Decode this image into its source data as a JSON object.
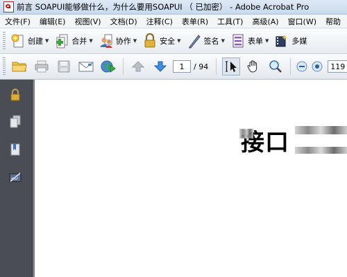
{
  "window": {
    "title": "前言 SOAPUI能够做什么，为什么要用SOAPUI （ 已加密） - Adobe Acrobat Pro"
  },
  "menubar": {
    "items": [
      {
        "label": "文件(F)"
      },
      {
        "label": "编辑(E)"
      },
      {
        "label": "视图(V)"
      },
      {
        "label": "文档(D)"
      },
      {
        "label": "注释(C)"
      },
      {
        "label": "表单(R)"
      },
      {
        "label": "工具(T)"
      },
      {
        "label": "高级(A)"
      },
      {
        "label": "窗口(W)"
      },
      {
        "label": "帮助"
      }
    ]
  },
  "toolbar": {
    "buttons": [
      {
        "label": "创建",
        "icon": "create-icon"
      },
      {
        "label": "合并",
        "icon": "combine-icon"
      },
      {
        "label": "协作",
        "icon": "collaborate-icon"
      },
      {
        "label": "安全",
        "icon": "lock-icon"
      },
      {
        "label": "签名",
        "icon": "pen-icon"
      },
      {
        "label": "表单",
        "icon": "forms-icon"
      },
      {
        "label": "多媒",
        "icon": "multimedia-icon"
      }
    ]
  },
  "navigation": {
    "current_page": "1",
    "total_pages": "/ 94",
    "zoom": "119"
  },
  "document": {
    "heading": "接口"
  },
  "colors": {
    "titlebar": "#c9d9ee",
    "leftnav": "#4a4e54",
    "page": "#ffffff"
  }
}
